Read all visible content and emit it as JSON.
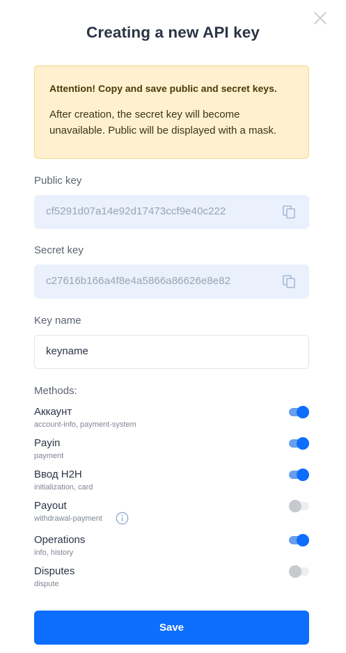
{
  "dialog": {
    "title": "Creating a new API key",
    "close_icon": "close-icon"
  },
  "alert": {
    "title": "Attention! Copy and save public and secret keys.",
    "text": "After creation, the secret key will become unavailable. Public will be displayed with a mask."
  },
  "public_key": {
    "label": "Public key",
    "value": "cf5291d07a14e92d17473ccf9e40c222",
    "icon": "copy-icon"
  },
  "secret_key": {
    "label": "Secret key",
    "value": "c27616b166a4f8e4a5866a86626e8e82",
    "icon": "copy-icon"
  },
  "key_name": {
    "label": "Key name",
    "value": "keyname"
  },
  "methods": {
    "label": "Methods:",
    "items": [
      {
        "name": "Аккаунт",
        "desc": "account-info, payment-system",
        "enabled": true
      },
      {
        "name": "Payin",
        "desc": "payment",
        "enabled": true
      },
      {
        "name": "Ввод H2H",
        "desc": "initialization, card",
        "enabled": true
      },
      {
        "name": "Payout",
        "desc": "withdrawal-payment",
        "enabled": false,
        "icon": "info-icon"
      },
      {
        "name": "Operations",
        "desc": "info, history",
        "enabled": true
      },
      {
        "name": "Disputes",
        "desc": "dispute",
        "enabled": false
      }
    ]
  },
  "actions": {
    "save_label": "Save"
  },
  "colors": {
    "accent": "#0d6efd",
    "alert_bg": "#fff1cf",
    "key_bg": "#eaf1fd"
  }
}
